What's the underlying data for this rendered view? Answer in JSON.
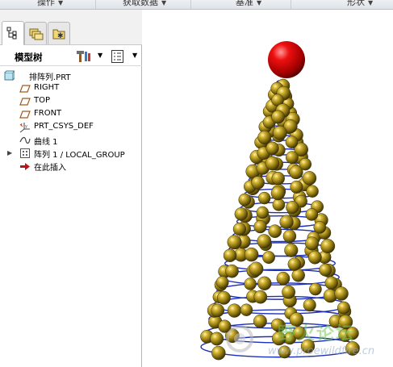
{
  "menubar": {
    "items": [
      {
        "label": "操作"
      },
      {
        "label": "获取数据"
      },
      {
        "label": "基准"
      },
      {
        "label": "形状"
      }
    ]
  },
  "left_panel": {
    "tabs": [
      {
        "icon": "model-tree-icon",
        "active": true
      },
      {
        "icon": "folder-browser-icon",
        "active": false
      },
      {
        "icon": "favorites-icon",
        "active": false
      }
    ],
    "header": {
      "title": "模型树",
      "tools_icon": "hammer-settings-icon",
      "show_icon": "tree-columns-icon"
    },
    "tree": [
      {
        "label": "排阵列.PRT",
        "icon": "part-icon"
      },
      {
        "label": "RIGHT",
        "icon": "datum-plane-icon"
      },
      {
        "label": "TOP",
        "icon": "datum-plane-icon"
      },
      {
        "label": "FRONT",
        "icon": "datum-plane-icon"
      },
      {
        "label": "PRT_CSYS_DEF",
        "icon": "coordinate-system-icon"
      },
      {
        "label": "曲线 1",
        "icon": "curve-icon"
      },
      {
        "label": "阵列 1 / LOCAL_GROUP",
        "icon": "pattern-icon"
      },
      {
        "label": "在此插入",
        "icon": "insert-arrow-icon"
      }
    ]
  },
  "viewport": {
    "watermark": {
      "brand": "野火论坛",
      "url": "www.proewildfire.cn"
    },
    "colors": {
      "helix": "#1c2fb8",
      "ball": "#8a7410",
      "top_sphere": "#d40000"
    }
  }
}
